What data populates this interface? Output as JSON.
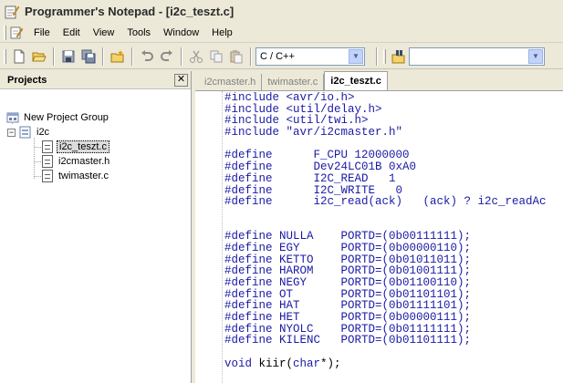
{
  "window": {
    "title": "Programmer's Notepad - [i2c_teszt.c]"
  },
  "menu": [
    "File",
    "Edit",
    "View",
    "Tools",
    "Window",
    "Help"
  ],
  "toolbar": {
    "language": "C / C++",
    "search_value": ""
  },
  "projects": {
    "title": "Projects",
    "group": "New Project Group",
    "project": "i2c",
    "files": [
      "i2c_teszt.c",
      "i2cmaster.h",
      "twimaster.c"
    ]
  },
  "tabs": [
    "i2cmaster.h",
    "twimaster.c",
    "i2c_teszt.c"
  ],
  "code_lines": [
    "#include <avr/io.h>",
    "#include <util/delay.h>",
    "#include <util/twi.h>",
    "#include \"avr/i2cmaster.h\"",
    "",
    "#define      F_CPU 12000000",
    "#define      Dev24LC01B 0xA0",
    "#define      I2C_READ   1",
    "#define      I2C_WRITE   0",
    "#define      i2c_read(ack)   (ack) ? i2c_readAc",
    "",
    "",
    "#define NULLA    PORTD=(0b00111111);",
    "#define EGY      PORTD=(0b00000110);",
    "#define KETTO    PORTD=(0b01011011);",
    "#define HAROM    PORTD=(0b01001111);",
    "#define NEGY     PORTD=(0b01100110);",
    "#define OT       PORTD=(0b01101101);",
    "#define HAT      PORTD=(0b01111101);",
    "#define HET      PORTD=(0b00000111);",
    "#define NYOLC    PORTD=(0b01111111);",
    "#define KILENC   PORTD=(0b01101111);",
    "",
    "void kiir(char*);"
  ]
}
